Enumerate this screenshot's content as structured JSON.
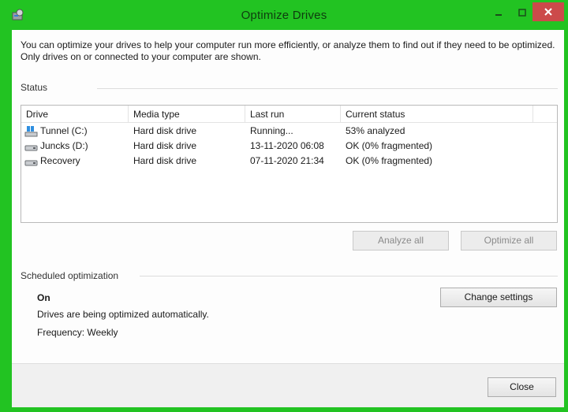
{
  "window": {
    "title": "Optimize Drives",
    "colors": {
      "frame": "#22c322",
      "close_button": "#cc4a4a",
      "client": "#fdfdfd"
    }
  },
  "description": "You can optimize your drives to help your computer run more efficiently, or analyze them to find out if they need to be optimized. Only drives on or connected to your computer are shown.",
  "status": {
    "label": "Status",
    "columns": [
      "Drive",
      "Media type",
      "Last run",
      "Current status"
    ],
    "drives": [
      {
        "icon": "system-drive-icon",
        "name": "Tunnel (C:)",
        "media_type": "Hard disk drive",
        "last_run": "Running...",
        "current_status": "53% analyzed"
      },
      {
        "icon": "hard-drive-icon",
        "name": "Juncks (D:)",
        "media_type": "Hard disk drive",
        "last_run": "13-11-2020 06:08",
        "current_status": "OK (0% fragmented)"
      },
      {
        "icon": "hard-drive-icon",
        "name": "Recovery",
        "media_type": "Hard disk drive",
        "last_run": "07-11-2020 21:34",
        "current_status": "OK (0% fragmented)"
      }
    ],
    "analyze_all_label": "Analyze all",
    "optimize_all_label": "Optimize all"
  },
  "scheduled": {
    "label": "Scheduled optimization",
    "state": "On",
    "message": "Drives are being optimized automatically.",
    "frequency": "Frequency: Weekly",
    "change_settings_label": "Change settings"
  },
  "footer": {
    "close_label": "Close"
  }
}
